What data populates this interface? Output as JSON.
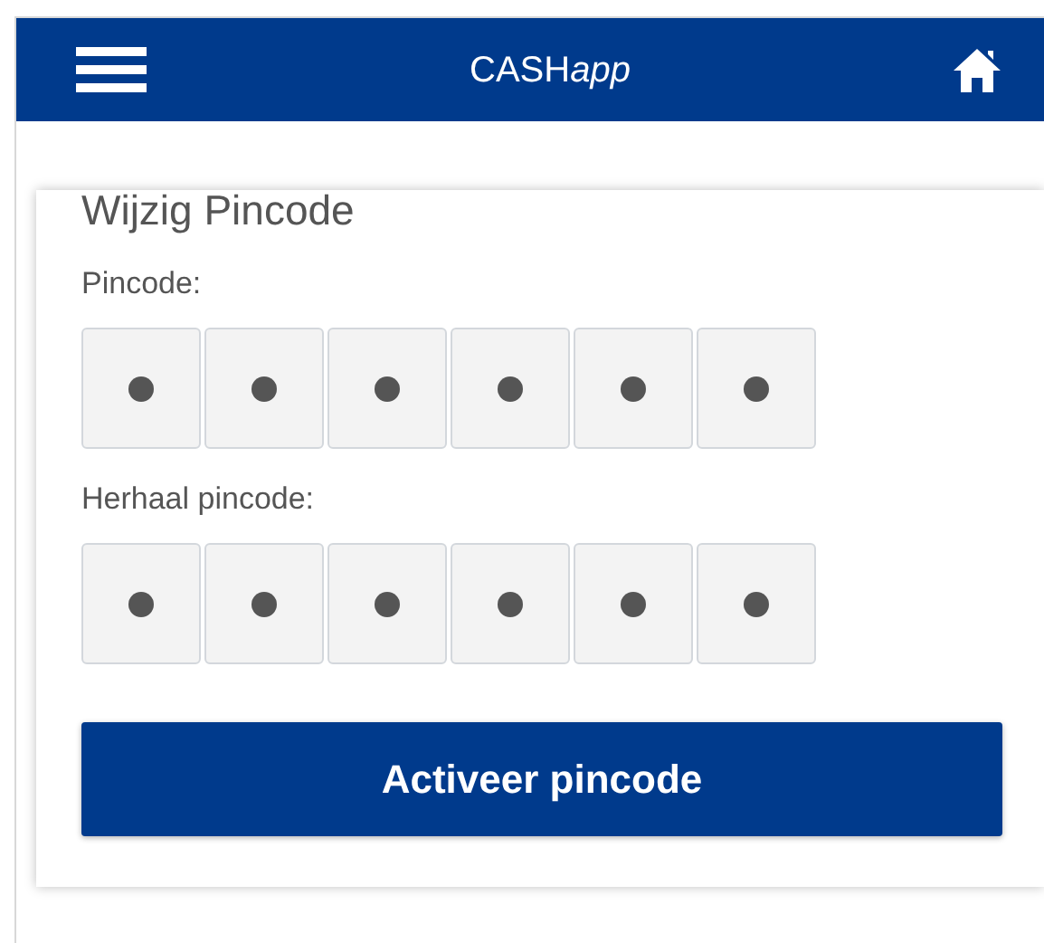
{
  "header": {
    "title": "CASH",
    "title_italic": "app"
  },
  "card": {
    "title": "Wijzig Pincode",
    "fields": [
      {
        "label": "Pincode:",
        "digits": [
          {
            "filled": true
          },
          {
            "filled": true
          },
          {
            "filled": true
          },
          {
            "filled": true
          },
          {
            "filled": true
          },
          {
            "filled": true
          }
        ]
      },
      {
        "label": "Herhaal pincode:",
        "digits": [
          {
            "filled": true
          },
          {
            "filled": true
          },
          {
            "filled": true
          },
          {
            "filled": true
          },
          {
            "filled": true
          },
          {
            "filled": true
          }
        ]
      }
    ],
    "button": "Activeer pincode"
  }
}
